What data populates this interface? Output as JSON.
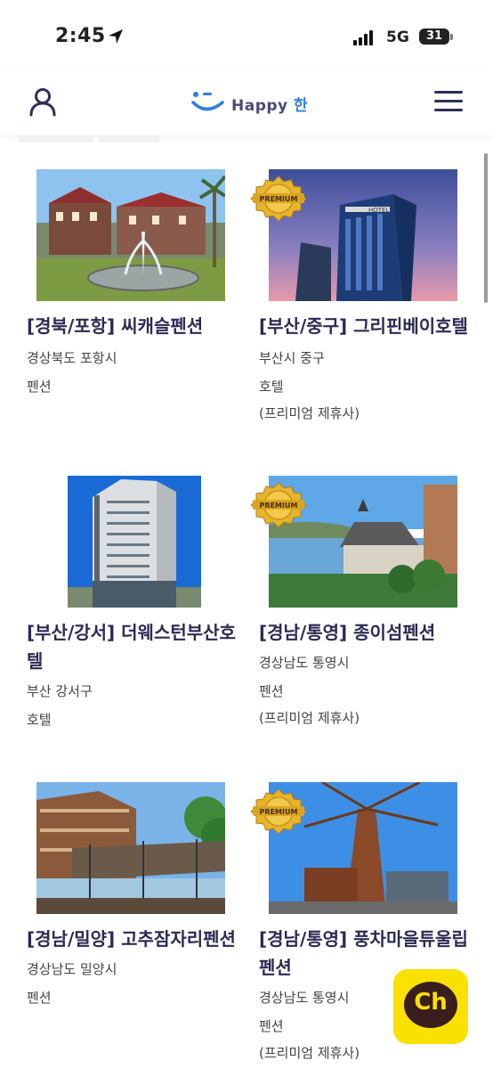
{
  "status_bar": {
    "time": "2:45",
    "network": "5G",
    "battery": "31"
  },
  "header": {
    "logo_text": "Happy ",
    "logo_han": "한"
  },
  "listings": [
    {
      "title": "[경북/포항] 씨캐슬펜션",
      "region": "경상북도 포항시",
      "type": "펜션",
      "premium": false,
      "premium_note": ""
    },
    {
      "title": "[부산/중구] 그리핀베이호텔",
      "region": "부산시 중구",
      "type": "호텔",
      "premium": true,
      "premium_note": "(프리미엄 제휴사)"
    },
    {
      "title": "[부산/강서] 더웨스턴부산호텔",
      "region": "부산 강서구",
      "type": "호텔",
      "premium": false,
      "premium_note": ""
    },
    {
      "title": "[경남/통영] 종이섬펜션",
      "region": "경상남도 통영시",
      "type": "펜션",
      "premium": true,
      "premium_note": "(프리미엄 제휴사)"
    },
    {
      "title": "[경남/밀양] 고추잠자리펜션",
      "region": "경상남도 밀양시",
      "type": "펜션",
      "premium": false,
      "premium_note": ""
    },
    {
      "title": "[경남/통영] 풍차마을튜울립펜션",
      "region": "경상남도 통영시",
      "type": "펜션",
      "premium": true,
      "premium_note": "(프리미엄 제휴사)"
    }
  ],
  "badge_text": "PREMIUM",
  "hotel_sign": "HOTEL",
  "kakao_button": {
    "label": "Ch"
  },
  "icons": [
    "location-arrow-icon",
    "user-icon",
    "menu-icon",
    "premium-badge-icon",
    "kakao-channel-icon"
  ],
  "colors": {
    "title": "#2a2a55",
    "kakao": "#FAE100",
    "badge_gold": "#d9a520"
  }
}
